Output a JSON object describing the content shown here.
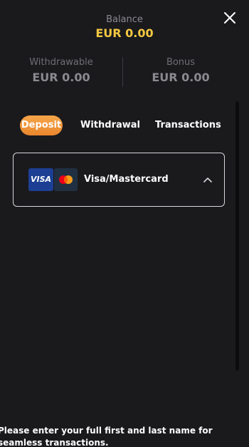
{
  "close": {
    "icon": "close-icon"
  },
  "balance": {
    "label": "Balance",
    "value": "EUR 0.00"
  },
  "withdrawable": {
    "label": "Withdrawable",
    "value": "EUR 0.00"
  },
  "bonus": {
    "label": "Bonus",
    "value": "EUR 0.00"
  },
  "tabs": [
    {
      "label": "Deposit",
      "active": true
    },
    {
      "label": "Withdrawal",
      "active": false
    },
    {
      "label": "Transactions",
      "active": false
    }
  ],
  "payment_method": {
    "visa_logo_text": "VISA",
    "mastercard_icon": "mastercard-icon",
    "label": "Visa/Mastercard",
    "expanded_icon": "chevron-up-icon"
  },
  "notice": "Please enter your full first and last name for seamless transactions.",
  "colors": {
    "background": "#1a1a1d",
    "accent_balance": "#f5c842",
    "active_tab": "#f09a3c",
    "visa_blue": "#1c3f94"
  }
}
